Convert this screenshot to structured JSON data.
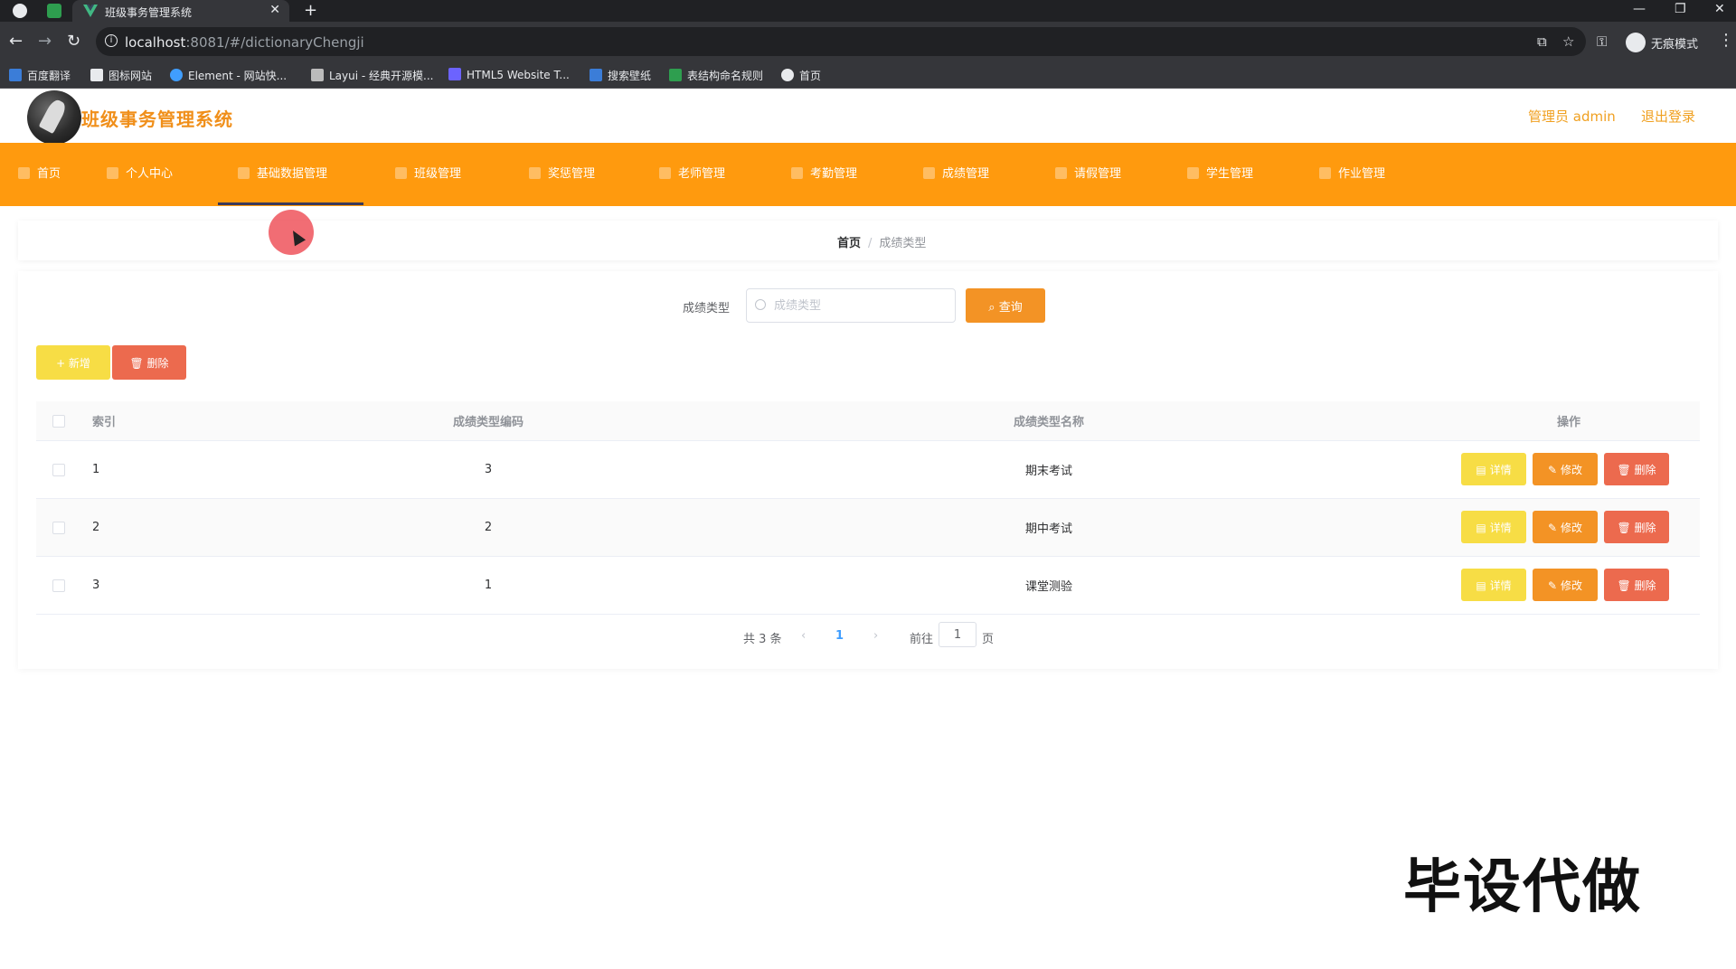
{
  "browser": {
    "tab_title": "班级事务管理系统",
    "url_host": "localhost",
    "url_path": ":8081/#/dictionaryChengji",
    "incognito_label": "无痕模式",
    "bookmarks": [
      "百度翻译",
      "图标网站",
      "Element - 网站快...",
      "Layui - 经典开源模...",
      "HTML5 Website T...",
      "搜索壁纸",
      "表结构命名规则",
      "首页"
    ]
  },
  "header": {
    "title": "班级事务管理系统",
    "admin_label": "管理员 admin",
    "logout_label": "退出登录",
    "accent": "#f08f1a"
  },
  "nav": {
    "color": "#ff9a0e",
    "items": [
      "首页",
      "个人中心",
      "基础数据管理",
      "班级管理",
      "奖惩管理",
      "老师管理",
      "考勤管理",
      "成绩管理",
      "请假管理",
      "学生管理",
      "作业管理"
    ],
    "active": "基础数据管理"
  },
  "breadcrumb": {
    "home": "首页",
    "separator": "/",
    "current": "成绩类型"
  },
  "search": {
    "label": "成绩类型",
    "placeholder": "成绩类型",
    "query_label": "查询"
  },
  "toolbar": {
    "add_label": "+ 新增",
    "delete_label": "删除"
  },
  "table": {
    "columns": [
      "索引",
      "成绩类型编码",
      "成绩类型名称",
      "操作"
    ],
    "rows": [
      {
        "index": "1",
        "code": "3",
        "name": "期末考试"
      },
      {
        "index": "2",
        "code": "2",
        "name": "期中考试"
      },
      {
        "index": "3",
        "code": "1",
        "name": "课堂测验"
      }
    ],
    "actions": {
      "detail": "详情",
      "edit": "修改",
      "remove": "删除"
    }
  },
  "pagination": {
    "total_label": "共 3 条",
    "prev": "‹",
    "current_page": "1",
    "next": "›",
    "goto_label": "前往",
    "goto_value": "1",
    "page_suffix": "页"
  },
  "watermark": "毕设代做"
}
